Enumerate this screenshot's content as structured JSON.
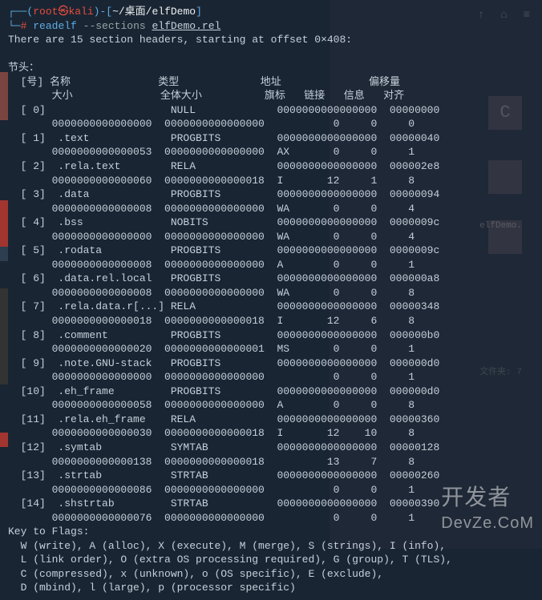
{
  "prompt": {
    "user": "root",
    "host": "kali",
    "path": "~/桌面/elfDemo",
    "symbol": "#",
    "command": "readelf",
    "flag": "--sections",
    "arg": "elfDemo.rel"
  },
  "header_line": "There are 15 section headers, starting at offset 0×408:",
  "section_header_title": "节头：",
  "col_headers": {
    "line1": {
      "num": "[号]",
      "name": "名称",
      "type": "类型",
      "addr": "地址",
      "offset": "偏移量"
    },
    "line2": {
      "size": "大小",
      "entsize": "全体大小",
      "flags": "旗标",
      "link": "链接",
      "info": "信息",
      "align": "对齐"
    }
  },
  "sections": [
    {
      "idx": "[ 0]",
      "name": "",
      "type": "NULL",
      "addr": "0000000000000000",
      "offset": "00000000",
      "size": "0000000000000000",
      "entsize": "0000000000000000",
      "flags": "",
      "link": "0",
      "info": "0",
      "align": "0"
    },
    {
      "idx": "[ 1]",
      "name": ".text",
      "type": "PROGBITS",
      "addr": "0000000000000000",
      "offset": "00000040",
      "size": "0000000000000053",
      "entsize": "0000000000000000",
      "flags": "AX",
      "link": "0",
      "info": "0",
      "align": "1"
    },
    {
      "idx": "[ 2]",
      "name": ".rela.text",
      "type": "RELA",
      "addr": "0000000000000000",
      "offset": "000002e8",
      "size": "0000000000000060",
      "entsize": "0000000000000018",
      "flags": "I",
      "link": "12",
      "info": "1",
      "align": "8"
    },
    {
      "idx": "[ 3]",
      "name": ".data",
      "type": "PROGBITS",
      "addr": "0000000000000000",
      "offset": "00000094",
      "size": "0000000000000008",
      "entsize": "0000000000000000",
      "flags": "WA",
      "link": "0",
      "info": "0",
      "align": "4"
    },
    {
      "idx": "[ 4]",
      "name": ".bss",
      "type": "NOBITS",
      "addr": "0000000000000000",
      "offset": "0000009c",
      "size": "0000000000000000",
      "entsize": "0000000000000000",
      "flags": "WA",
      "link": "0",
      "info": "0",
      "align": "4"
    },
    {
      "idx": "[ 5]",
      "name": ".rodata",
      "type": "PROGBITS",
      "addr": "0000000000000000",
      "offset": "0000009c",
      "size": "0000000000000008",
      "entsize": "0000000000000000",
      "flags": "A",
      "link": "0",
      "info": "0",
      "align": "1"
    },
    {
      "idx": "[ 6]",
      "name": ".data.rel.local",
      "type": "PROGBITS",
      "addr": "0000000000000000",
      "offset": "000000a8",
      "size": "0000000000000008",
      "entsize": "0000000000000000",
      "flags": "WA",
      "link": "0",
      "info": "0",
      "align": "8"
    },
    {
      "idx": "[ 7]",
      "name": ".rela.data.r[...]",
      "type": "RELA",
      "addr": "0000000000000000",
      "offset": "00000348",
      "size": "0000000000000018",
      "entsize": "0000000000000018",
      "flags": "I",
      "link": "12",
      "info": "6",
      "align": "8"
    },
    {
      "idx": "[ 8]",
      "name": ".comment",
      "type": "PROGBITS",
      "addr": "0000000000000000",
      "offset": "000000b0",
      "size": "0000000000000020",
      "entsize": "0000000000000001",
      "flags": "MS",
      "link": "0",
      "info": "0",
      "align": "1"
    },
    {
      "idx": "[ 9]",
      "name": ".note.GNU-stack",
      "type": "PROGBITS",
      "addr": "0000000000000000",
      "offset": "000000d0",
      "size": "0000000000000000",
      "entsize": "0000000000000000",
      "flags": "",
      "link": "0",
      "info": "0",
      "align": "1"
    },
    {
      "idx": "[10]",
      "name": ".eh_frame",
      "type": "PROGBITS",
      "addr": "0000000000000000",
      "offset": "000000d0",
      "size": "0000000000000058",
      "entsize": "0000000000000000",
      "flags": "A",
      "link": "0",
      "info": "0",
      "align": "8"
    },
    {
      "idx": "[11]",
      "name": ".rela.eh_frame",
      "type": "RELA",
      "addr": "0000000000000000",
      "offset": "00000360",
      "size": "0000000000000030",
      "entsize": "0000000000000018",
      "flags": "I",
      "link": "12",
      "info": "10",
      "align": "8"
    },
    {
      "idx": "[12]",
      "name": ".symtab",
      "type": "SYMTAB",
      "addr": "0000000000000000",
      "offset": "00000128",
      "size": "0000000000000138",
      "entsize": "0000000000000018",
      "flags": "",
      "link": "13",
      "info": "7",
      "align": "8"
    },
    {
      "idx": "[13]",
      "name": ".strtab",
      "type": "STRTAB",
      "addr": "0000000000000000",
      "offset": "00000260",
      "size": "0000000000000086",
      "entsize": "0000000000000000",
      "flags": "",
      "link": "0",
      "info": "0",
      "align": "1"
    },
    {
      "idx": "[14]",
      "name": ".shstrtab",
      "type": "STRTAB",
      "addr": "0000000000000000",
      "offset": "00000390",
      "size": "0000000000000076",
      "entsize": "0000000000000000",
      "flags": "",
      "link": "0",
      "info": "0",
      "align": "1"
    }
  ],
  "key_flags": {
    "title": "Key to Flags:",
    "lines": [
      "W (write), A (alloc), X (execute), M (merge), S (strings), I (info),",
      "L (link order), O (extra OS processing required), G (group), T (TLS),",
      "C (compressed), x (unknown), o (OS specific), E (exclude),",
      "D (mbind), l (large), p (processor specific)"
    ]
  },
  "watermark": "开发者\nDevZe.CoM",
  "watermark_cn": "开发者",
  "watermark_en": "DevZe.CoM",
  "bg_label": "elfDemo.",
  "bg_file_label": "文件夹: 7",
  "bg_icon_letter": "C"
}
